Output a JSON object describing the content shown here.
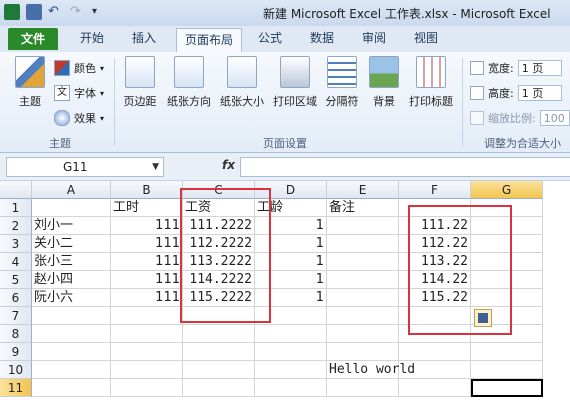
{
  "window": {
    "title": "新建 Microsoft Excel 工作表.xlsx - Microsoft Excel"
  },
  "quick_access": [
    "excel-logo-icon",
    "save-icon",
    "undo-icon",
    "redo-icon",
    "customize-icon"
  ],
  "tabs": [
    {
      "label": "文件"
    },
    {
      "label": "开始"
    },
    {
      "label": "插入"
    },
    {
      "label": "页面布局"
    },
    {
      "label": "公式"
    },
    {
      "label": "数据"
    },
    {
      "label": "审阅"
    },
    {
      "label": "视图"
    }
  ],
  "ribbon": {
    "theme": {
      "main_label": "主题",
      "colors": "颜色",
      "fonts": "字体",
      "effects": "效果",
      "group": "主题"
    },
    "page_setup": {
      "buttons": [
        "页边距",
        "纸张方向",
        "纸张大小",
        "打印区域",
        "分隔符",
        "背景",
        "打印标题"
      ],
      "group": "页面设置"
    },
    "scale": {
      "width_label": "宽度:",
      "width_value": "1 页",
      "height_label": "高度:",
      "height_value": "1 页",
      "scale_label": "缩放比例:",
      "scale_value": "100",
      "group": "调整为合适大小"
    }
  },
  "formula_bar": {
    "name_box": "G11",
    "fx": "fx",
    "content": ""
  },
  "columns": [
    "A",
    "B",
    "C",
    "D",
    "E",
    "F",
    "G"
  ],
  "selected_column": "G",
  "rows": [
    "1",
    "2",
    "3",
    "4",
    "5",
    "6",
    "7",
    "8",
    "9",
    "10",
    "11"
  ],
  "selected_row": "11",
  "cells": {
    "B1": "工时",
    "C1": "工资",
    "D1": "工龄",
    "E1": "备注",
    "A2": "刘小一",
    "B2": "111",
    "C2": "111.2222",
    "D2": "1",
    "F2": "111.22",
    "A3": "关小二",
    "B3": "111",
    "C3": "112.2222",
    "D3": "1",
    "F3": "112.22",
    "A4": "张小三",
    "B4": "111",
    "C4": "113.2222",
    "D4": "1",
    "F4": "113.22",
    "A5": "赵小四",
    "B5": "111",
    "C5": "114.2222",
    "D5": "1",
    "F5": "114.22",
    "A6": "阮小六",
    "B6": "111",
    "C6": "115.2222",
    "D6": "1",
    "F6": "115.22",
    "E10": "Hello world"
  },
  "colors": {
    "file_tab": "#2a8a2a",
    "highlight_box": "#d9333f",
    "selection_header": "#f3c552"
  }
}
